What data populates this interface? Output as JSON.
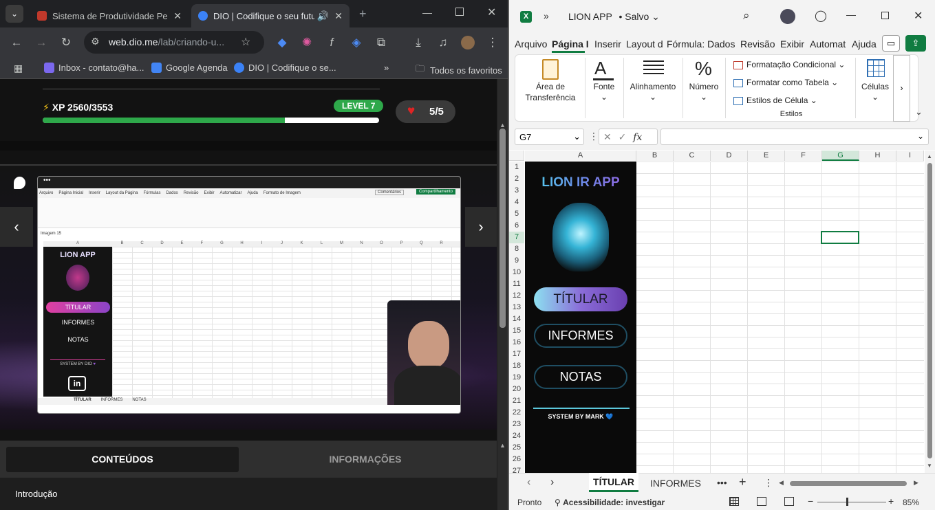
{
  "browser": {
    "tabs": [
      {
        "title": "Sistema de Produtividade Pesso",
        "active": false
      },
      {
        "title": "DIO | Codifique o seu futuro",
        "active": true
      }
    ],
    "url_host": "web.dio.me",
    "url_path": "/lab/criando-u...",
    "bookmarks": [
      "Inbox - contato@ha...",
      "Google Agenda",
      "DIO | Codifique o se..."
    ],
    "bookmarks_more": "»",
    "all_bookmarks": "Todos os favoritos"
  },
  "dio": {
    "xp_label": "XP 2560/3553",
    "xp_progress": 0.72,
    "level": "LEVEL 7",
    "lives": "5/5",
    "tab_contents": "CONTEÚDOS",
    "tab_info": "INFORMAÇÕES",
    "intro": "Introdução"
  },
  "video": {
    "ribbon_tabs": [
      "Arquivo",
      "Página Inicial",
      "Inserir",
      "Layout da Página",
      "Fórmulas",
      "Dados",
      "Revisão",
      "Exibir",
      "Automatizar",
      "Ajuda",
      "Formato de Imagem"
    ],
    "comments": "Comentários",
    "share": "Compartilhamento",
    "namebox": "Imagem 15",
    "app_title": "LION APP",
    "buttons": [
      "TÍTULAR",
      "INFORMES",
      "NOTAS"
    ],
    "footer": "SYSTEM BY DIO",
    "sheet_tabs": [
      "TÍTULAR",
      "INFORMES",
      "NOTAS"
    ],
    "cols": [
      "A",
      "B",
      "C",
      "D",
      "E",
      "F",
      "G",
      "H",
      "I",
      "J",
      "K",
      "L",
      "M",
      "N",
      "O",
      "P",
      "Q",
      "R"
    ]
  },
  "excel": {
    "title": "LION APP",
    "saved": "• Salvo",
    "ribbon_tabs": [
      "Arquivo",
      "Página I",
      "Inserir",
      "Layout d",
      "Fórmula:",
      "Dados",
      "Revisão",
      "Exibir",
      "Automat",
      "Ajuda"
    ],
    "clipboard": "Área de Transferência",
    "font": "Fonte",
    "alignment": "Alinhamento",
    "number": "Número",
    "cond_format": "Formatação Condicional",
    "format_table": "Formatar como Tabela",
    "cell_styles": "Estilos de Célula",
    "styles_group": "Estilos",
    "cells": "Células",
    "namebox": "G7",
    "fx": "fx",
    "columns": [
      "A",
      "B",
      "C",
      "D",
      "E",
      "F",
      "G",
      "H",
      "I"
    ],
    "rows": [
      "1",
      "2",
      "3",
      "4",
      "5",
      "6",
      "7",
      "8",
      "9",
      "10",
      "11",
      "12",
      "13",
      "14",
      "15",
      "16",
      "17",
      "18",
      "19",
      "20",
      "21",
      "22",
      "23",
      "24",
      "25",
      "26",
      "27"
    ],
    "app_title": "LION IR APP",
    "btn_titular": "TÍTULAR",
    "btn_informes": "INFORMES",
    "btn_notas": "NOTAS",
    "system_by": "SYSTEM BY MARK 💙",
    "sheet_tabs": [
      "TÍTULAR",
      "INFORMES"
    ],
    "status_ready": "Pronto",
    "accessibility": "Acessibilidade: investigar",
    "zoom": "85%"
  },
  "colors": {
    "dio_green": "#2ea84a",
    "excel_green": "#107c41",
    "chrome_bg": "#202124"
  }
}
